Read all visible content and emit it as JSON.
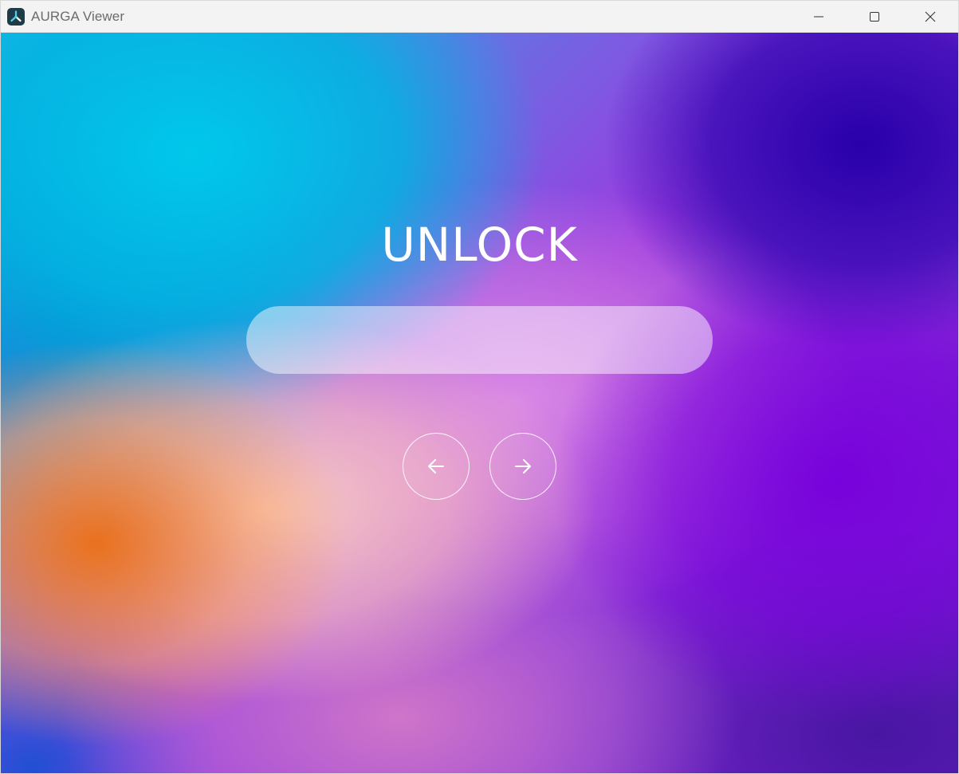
{
  "window": {
    "title": "AURGA Viewer",
    "app_icon": "aurga-logo-icon",
    "controls": {
      "minimize_icon": "minimize-icon",
      "maximize_icon": "maximize-icon",
      "close_icon": "close-icon"
    }
  },
  "unlock": {
    "heading": "UNLOCK",
    "password_value": "",
    "back_icon": "arrow-left-icon",
    "next_icon": "arrow-right-icon"
  },
  "colors": {
    "titlebar_bg": "#f3f3f3",
    "title_text": "#6b6b6b",
    "logo_bg": "#1f3b48",
    "logo_accent": "#4fd1e8",
    "heading_text": "#ffffff"
  }
}
